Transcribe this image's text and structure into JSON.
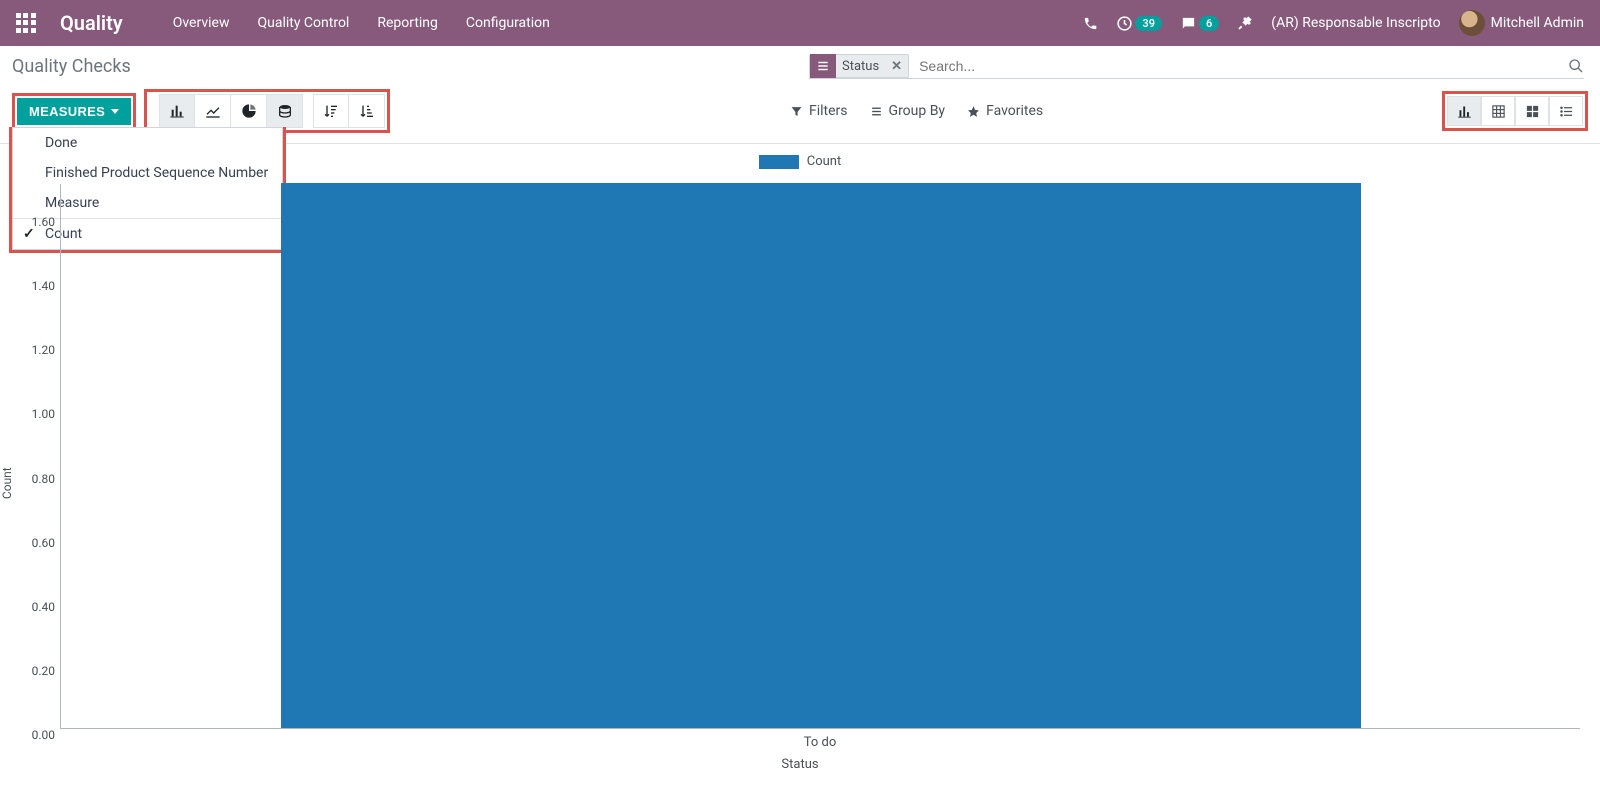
{
  "navbar": {
    "brand": "Quality",
    "links": [
      "Overview",
      "Quality Control",
      "Reporting",
      "Configuration"
    ],
    "activity_badge": "39",
    "discuss_badge": "6",
    "company": "(AR) Responsable Inscripto",
    "user": "Mitchell Admin"
  },
  "breadcrumb": "Quality Checks",
  "search": {
    "facet_label": "Status",
    "placeholder": "Search..."
  },
  "toolbar": {
    "measures_label": "MEASURES",
    "filters": "Filters",
    "group_by": "Group By",
    "favorites": "Favorites"
  },
  "measures_menu": {
    "items": [
      "Done",
      "Finished Product Sequence Number",
      "Measure"
    ],
    "checked": "Count"
  },
  "chart_data": {
    "type": "bar",
    "title": "",
    "legend": "Count",
    "xlabel": "Status",
    "ylabel": "Count",
    "yticks": [
      "0.00",
      "0.20",
      "0.40",
      "0.60",
      "0.80",
      "1.00",
      "1.20",
      "1.40",
      "1.60"
    ],
    "ylim": [
      0,
      1.7
    ],
    "categories": [
      "To do"
    ],
    "values": [
      1.7
    ],
    "color": "#1f77b4"
  }
}
